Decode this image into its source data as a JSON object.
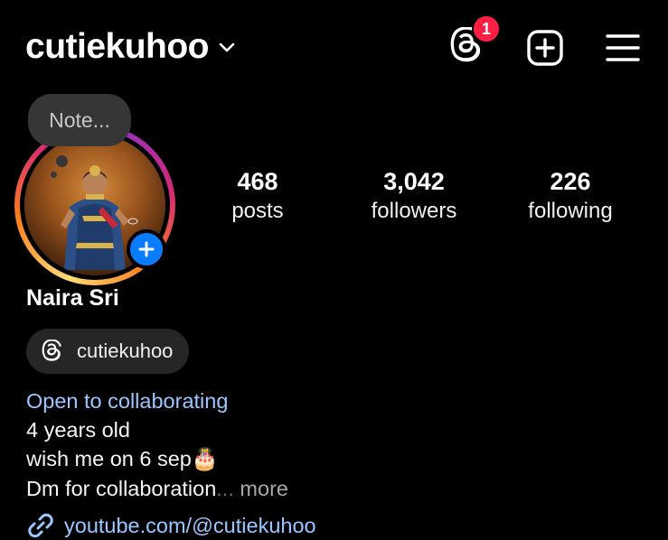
{
  "header": {
    "username": "cutiekuhoo",
    "threads_badge_count": "1"
  },
  "note": {
    "placeholder": "Note..."
  },
  "stats": {
    "posts": {
      "count": "468",
      "label": "posts"
    },
    "followers": {
      "count": "3,042",
      "label": "followers"
    },
    "following": {
      "count": "226",
      "label": "following"
    }
  },
  "profile": {
    "display_name": "Naira Sri",
    "threads_handle": "cutiekuhoo"
  },
  "bio": {
    "category": "Open to collaborating",
    "line1": "4 years old",
    "line2": "wish me on 6 sep",
    "line2_emoji": "🎂",
    "line3": "Dm for collaboration",
    "ellipsis": "...",
    "more": "more"
  },
  "link": {
    "url": "youtube.com/@cutiekuhoo"
  },
  "colors": {
    "background": "#000000",
    "link": "#9ac7ff",
    "badge": "#ff1f45",
    "add_story": "#0a7cff",
    "pill": "#262626"
  },
  "icons": {
    "chevron": "chevron-down-icon",
    "threads": "threads-icon",
    "create": "plus-square-icon",
    "menu": "hamburger-menu-icon",
    "add_story": "plus-icon",
    "link": "link-icon"
  }
}
